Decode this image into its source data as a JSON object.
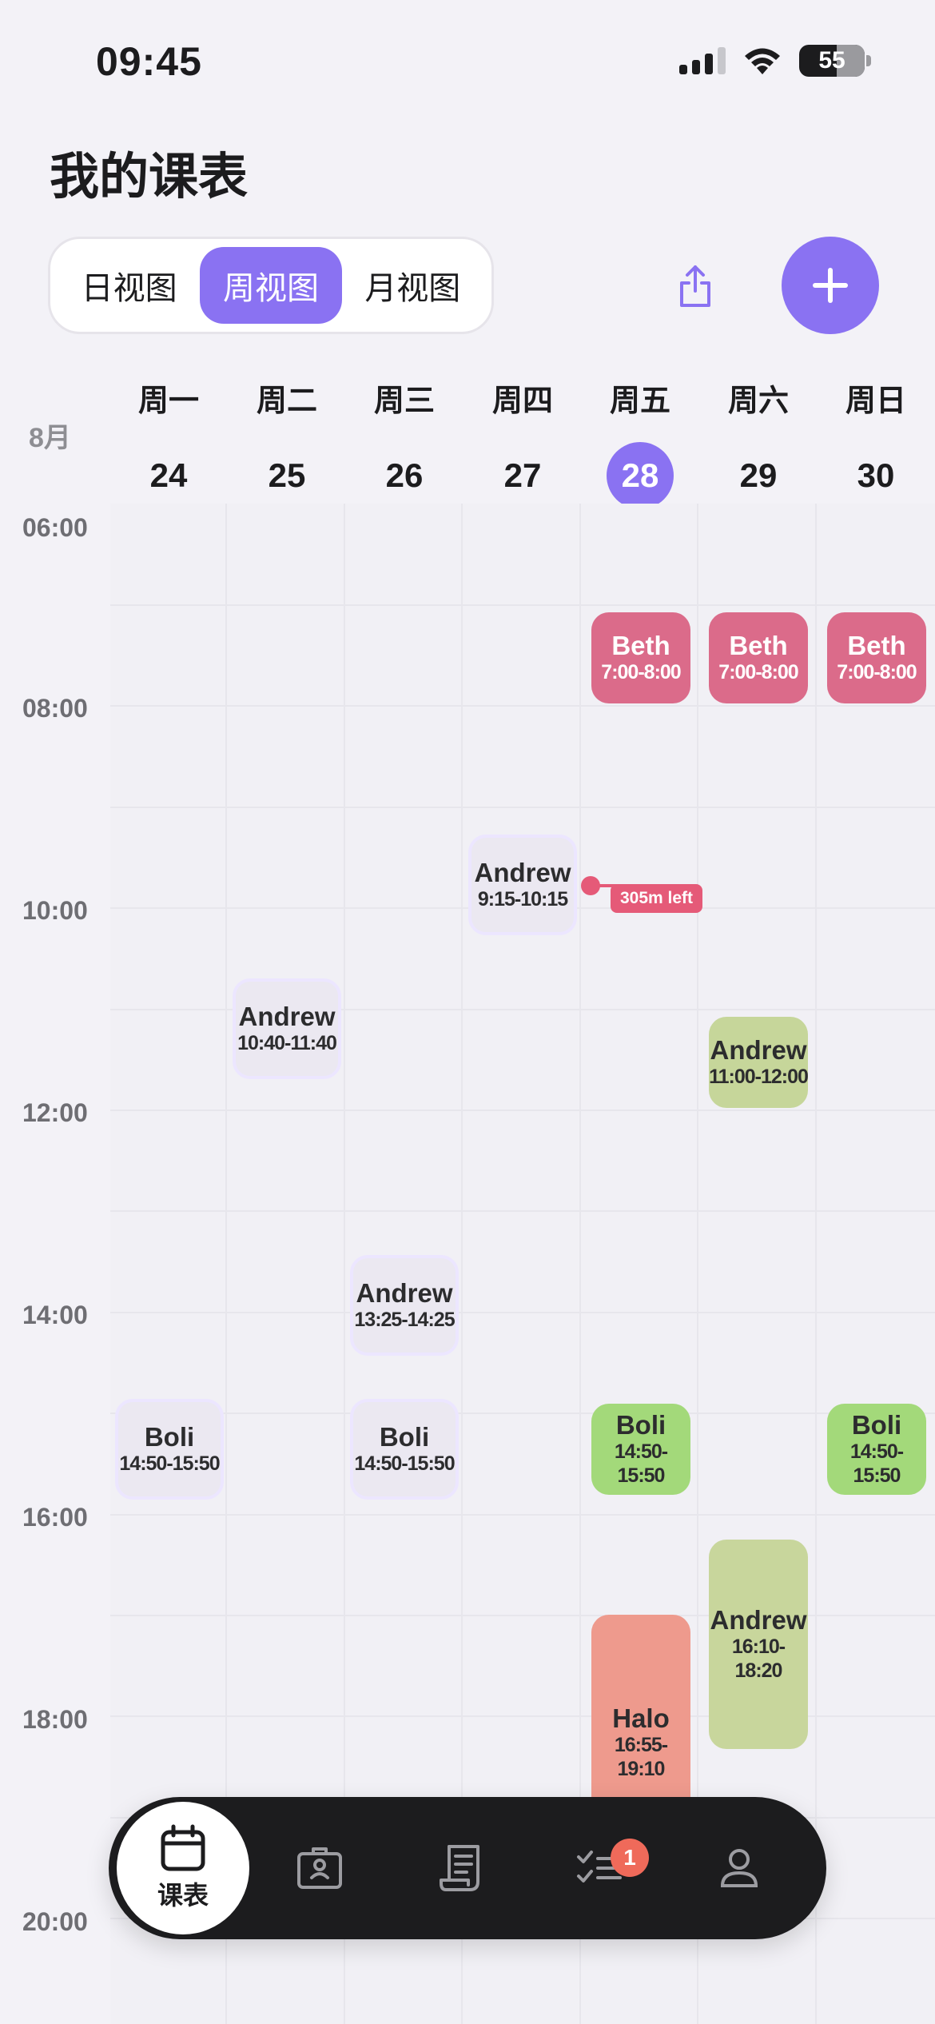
{
  "status_bar": {
    "time": "09:45",
    "battery": "55"
  },
  "title": "我的课表",
  "view_tabs": [
    {
      "label": "日视图",
      "active": false
    },
    {
      "label": "周视图",
      "active": true
    },
    {
      "label": "月视图",
      "active": false
    }
  ],
  "header": {
    "month": "8月",
    "days": [
      {
        "name": "周一",
        "num": "24"
      },
      {
        "name": "周二",
        "num": "25"
      },
      {
        "name": "周三",
        "num": "26"
      },
      {
        "name": "周四",
        "num": "27"
      },
      {
        "name": "周五",
        "num": "28",
        "today": true
      },
      {
        "name": "周六",
        "num": "29"
      },
      {
        "name": "周日",
        "num": "30"
      }
    ]
  },
  "time_labels": [
    "06:00",
    "08:00",
    "10:00",
    "12:00",
    "14:00",
    "16:00",
    "18:00",
    "20:00"
  ],
  "events": [
    {
      "name": "Beth",
      "time": "7:00-8:00",
      "day": 4,
      "color": "pink"
    },
    {
      "name": "Beth",
      "time": "7:00-8:00",
      "day": 5,
      "color": "pink"
    },
    {
      "name": "Beth",
      "time": "7:00-8:00",
      "day": 6,
      "color": "pink"
    },
    {
      "name": "Andrew",
      "time": "9:15-10:15",
      "day": 3,
      "color": "lavender"
    },
    {
      "name": "Andrew",
      "time": "10:40-11:40",
      "day": 1,
      "color": "lavender"
    },
    {
      "name": "Andrew",
      "time": "11:00-12:00",
      "day": 5,
      "color": "olive"
    },
    {
      "name": "Andrew",
      "time": "13:25-14:25",
      "day": 2,
      "color": "lavender"
    },
    {
      "name": "Boli",
      "time": "14:50-15:50",
      "day": 0,
      "color": "lavender"
    },
    {
      "name": "Boli",
      "time": "14:50-15:50",
      "day": 2,
      "color": "lavender"
    },
    {
      "name": "Boli",
      "time": "14:50-15:50",
      "day": 4,
      "color": "green"
    },
    {
      "name": "Boli",
      "time": "14:50-15:50",
      "day": 6,
      "color": "green"
    },
    {
      "name": "Andrew",
      "time": "16:10-18:20",
      "day": 5,
      "color": "sage"
    },
    {
      "name": "Halo",
      "time": "16:55-19:10",
      "day": 4,
      "color": "salmon"
    }
  ],
  "now_indicator": {
    "label": "305m left"
  },
  "tabbar": {
    "items": [
      {
        "icon": "calendar-icon",
        "label": "课表",
        "active": true
      },
      {
        "icon": "id-card-icon",
        "label": ""
      },
      {
        "icon": "receipt-icon",
        "label": ""
      },
      {
        "icon": "checklist-icon",
        "label": "",
        "badge": "1"
      },
      {
        "icon": "person-icon",
        "label": ""
      }
    ]
  },
  "colors": {
    "accent": "#8a72f2",
    "pink": "#db6b8a",
    "green": "#a3d97a",
    "salmon": "#ee9a8d"
  }
}
